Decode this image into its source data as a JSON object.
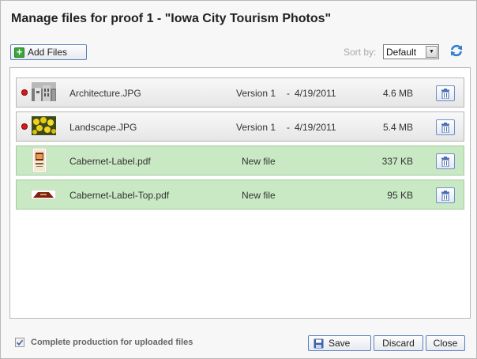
{
  "dialog": {
    "title": "Manage files for proof 1 - \"Iowa City Tourism Photos\""
  },
  "toolbar": {
    "add_files_label": "Add Files",
    "sort_label": "Sort by:",
    "sort_value": "Default"
  },
  "files": [
    {
      "name": "Architecture.JPG",
      "version": "Version 1",
      "dash": "-",
      "date": "4/19/2011",
      "size": "4.6 MB",
      "status": "existing"
    },
    {
      "name": "Landscape.JPG",
      "version": "Version 1",
      "dash": "-",
      "date": "4/19/2011",
      "size": "5.4 MB",
      "status": "existing"
    },
    {
      "name": "Cabernet-Label.pdf",
      "status_text": "New file",
      "size": "337 KB",
      "status": "new"
    },
    {
      "name": "Cabernet-Label-Top.pdf",
      "status_text": "New file",
      "size": "95 KB",
      "status": "new"
    }
  ],
  "footer": {
    "checkbox_label": "Complete production for uploaded files",
    "checkbox_checked": true,
    "save_label": "Save",
    "discard_label": "Discard",
    "close_label": "Close"
  },
  "colors": {
    "new_row": "#c9e8c4",
    "status_dot": "#d41b1b",
    "button_border": "#5b7fbd"
  }
}
